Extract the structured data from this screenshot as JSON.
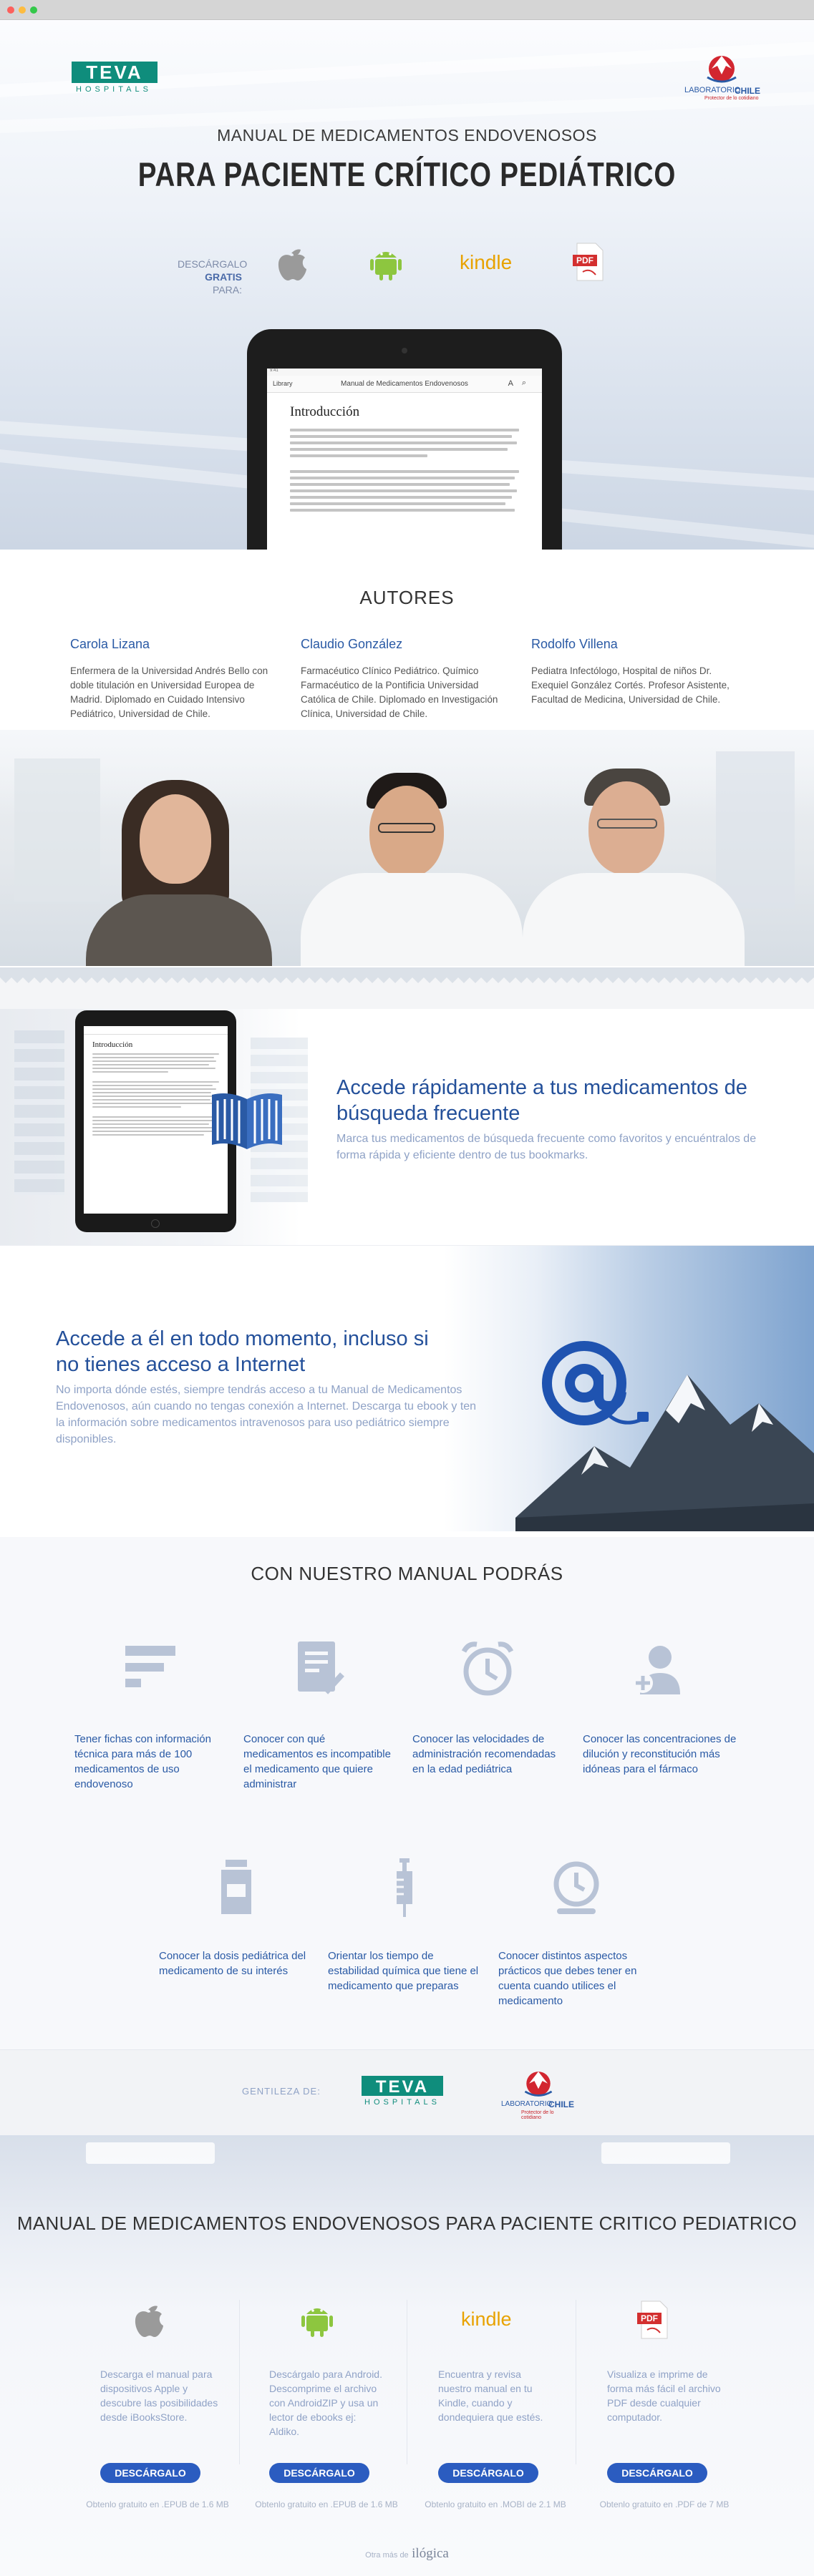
{
  "hero": {
    "logo_teva": "TEVA",
    "logo_teva_sub": "HOSPITALS",
    "logo_lab": "LABORATORIO",
    "logo_lab_chile": "CHILE",
    "logo_lab_tag": "Protector de lo cotidiano",
    "title_line1": "MANUAL DE MEDICAMENTOS ENDOVENOSOS",
    "title_line2": "PARA PACIENTE CRÍTICO PEDIÁTRICO",
    "download_label_1": "DESCÁRGALO",
    "download_label_2": "GRATIS",
    "download_label_3": "PARA:",
    "kindle": "kindle",
    "pdf": "PDF"
  },
  "ipad": {
    "nav_left": "Library",
    "title": "Manual de Medicamentos Endovenosos",
    "toolbar": "A",
    "heading": "Introducción"
  },
  "authors": {
    "title": "AUTORES",
    "people": [
      {
        "name": "Carola Lizana",
        "desc": "Enfermera de la Universidad Andrés Bello con doble titulación en Universidad Europea de Madrid. Diplomado en Cuidado Intensivo Pediátrico, Universidad de Chile."
      },
      {
        "name": "Claudio González",
        "desc": "Farmacéutico Clínico Pediátrico. Químico Farmacéutico de la Pontificia Universidad Católica de Chile. Diplomado en Investigación Clínica, Universidad de Chile."
      },
      {
        "name": "Rodolfo Villena",
        "desc": "Pediatra Infectólogo, Hospital de niños Dr. Exequiel González Cortés. Profesor Asistente, Facultad de Medicina, Universidad de Chile."
      }
    ]
  },
  "feature1": {
    "title": "Accede rápidamente a tus medicamentos de búsqueda frecuente",
    "desc": "Marca tus medicamentos de búsqueda frecuente como favoritos y encuéntralos de forma rápida y eficiente dentro de tus bookmarks.",
    "tablet_heading": "Introducción"
  },
  "feature2": {
    "title": "Accede a él en todo momento, incluso si no tienes acceso a Internet",
    "desc": "No importa dónde estés, siempre tendrás acceso a tu Manual de Medicamentos Endovenosos, aún cuando no tengas conexión a Internet. Descarga tu ebook y ten la información sobre medicamentos intravenosos para uso pediátrico siempre disponibles."
  },
  "podras": {
    "title": "CON NUESTRO MANUAL PODRÁS",
    "items": [
      "Tener fichas con información técnica para más de 100 medicamentos de uso endovenoso",
      "Conocer con qué medicamentos es incompatible el medicamento que quiere administrar",
      "Conocer las velocidades de administración recomendadas en la edad pediátrica",
      "Conocer las concentraciones de dilución y reconstitución más idóneas para el fármaco",
      "Conocer la dosis pediátrica del medicamento de su interés",
      "Orientar los tiempo de estabilidad química que tiene el medicamento que preparas",
      "Conocer distintos aspectos prácticos que debes tener en cuenta cuando utilices el medicamento"
    ]
  },
  "courtesy": {
    "label": "GENTILEZA DE:"
  },
  "download": {
    "title": "MANUAL DE MEDICAMENTOS ENDOVENOSOS PARA PACIENTE CRITICO PEDIATRICO",
    "columns": [
      {
        "desc": "Descarga el manual para dispositivos Apple y descubre las posibilidades desde iBooksStore.",
        "button": "DESCÁRGALO",
        "foot": "Obtenlo gratuito en .EPUB de 1.6 MB"
      },
      {
        "desc": "Descárgalo para Android. Descomprime el archivo con AndroidZIP y usa un lector de ebooks ej: Aldiko.",
        "button": "DESCÁRGALO",
        "foot": "Obtenlo gratuito en .EPUB de 1.6 MB"
      },
      {
        "desc": "Encuentra y revisa nuestro manual en tu Kindle, cuando y dondequiera que estés.",
        "button": "DESCÁRGALO",
        "foot": "Obtenlo gratuito en .MOBI de 2.1 MB"
      },
      {
        "desc": "Visualiza e imprime de forma más fácil el archivo PDF desde cualquier computador.",
        "button": "DESCÁRGALO",
        "foot": "Obtenlo gratuito en .PDF de 7 MB"
      }
    ],
    "kindle": "kindle",
    "pdf": "PDF",
    "footer_prefix": "Otra más de",
    "footer_brand": "ilógica"
  },
  "colors": {
    "accent_blue": "#2a5aa5",
    "teva_green": "#0f8d7c",
    "android_green": "#8dc63f",
    "kindle_orange": "#e8a200",
    "pdf_red": "#d32f2f",
    "button_blue": "#2b5cc0"
  }
}
